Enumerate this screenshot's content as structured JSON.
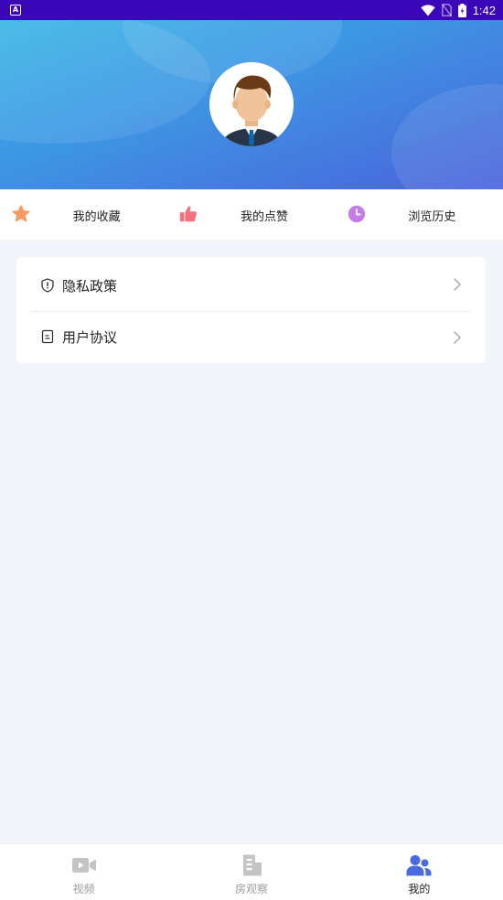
{
  "status_bar": {
    "time": "1:42",
    "app_icon_letter": "A"
  },
  "header": {
    "avatar": "user-avatar"
  },
  "shortcuts": [
    {
      "label": "我的收藏",
      "icon": "star-icon",
      "color": "#f59a62"
    },
    {
      "label": "我的点赞",
      "icon": "thumbs-up-icon",
      "color": "#f2717c"
    },
    {
      "label": "浏览历史",
      "icon": "clock-icon",
      "color": "#c47de6"
    }
  ],
  "menu": [
    {
      "label": "隐私政策",
      "icon": "shield-icon"
    },
    {
      "label": "用户协议",
      "icon": "document-icon"
    }
  ],
  "bottom_nav": [
    {
      "label": "视频",
      "icon": "video-icon",
      "active": false
    },
    {
      "label": "房观察",
      "icon": "building-icon",
      "active": false
    },
    {
      "label": "我的",
      "icon": "users-icon",
      "active": true
    }
  ],
  "colors": {
    "accent": "#4b6ae0",
    "status_bar": "#3b07b8",
    "inactive": "#c4c4c4"
  }
}
